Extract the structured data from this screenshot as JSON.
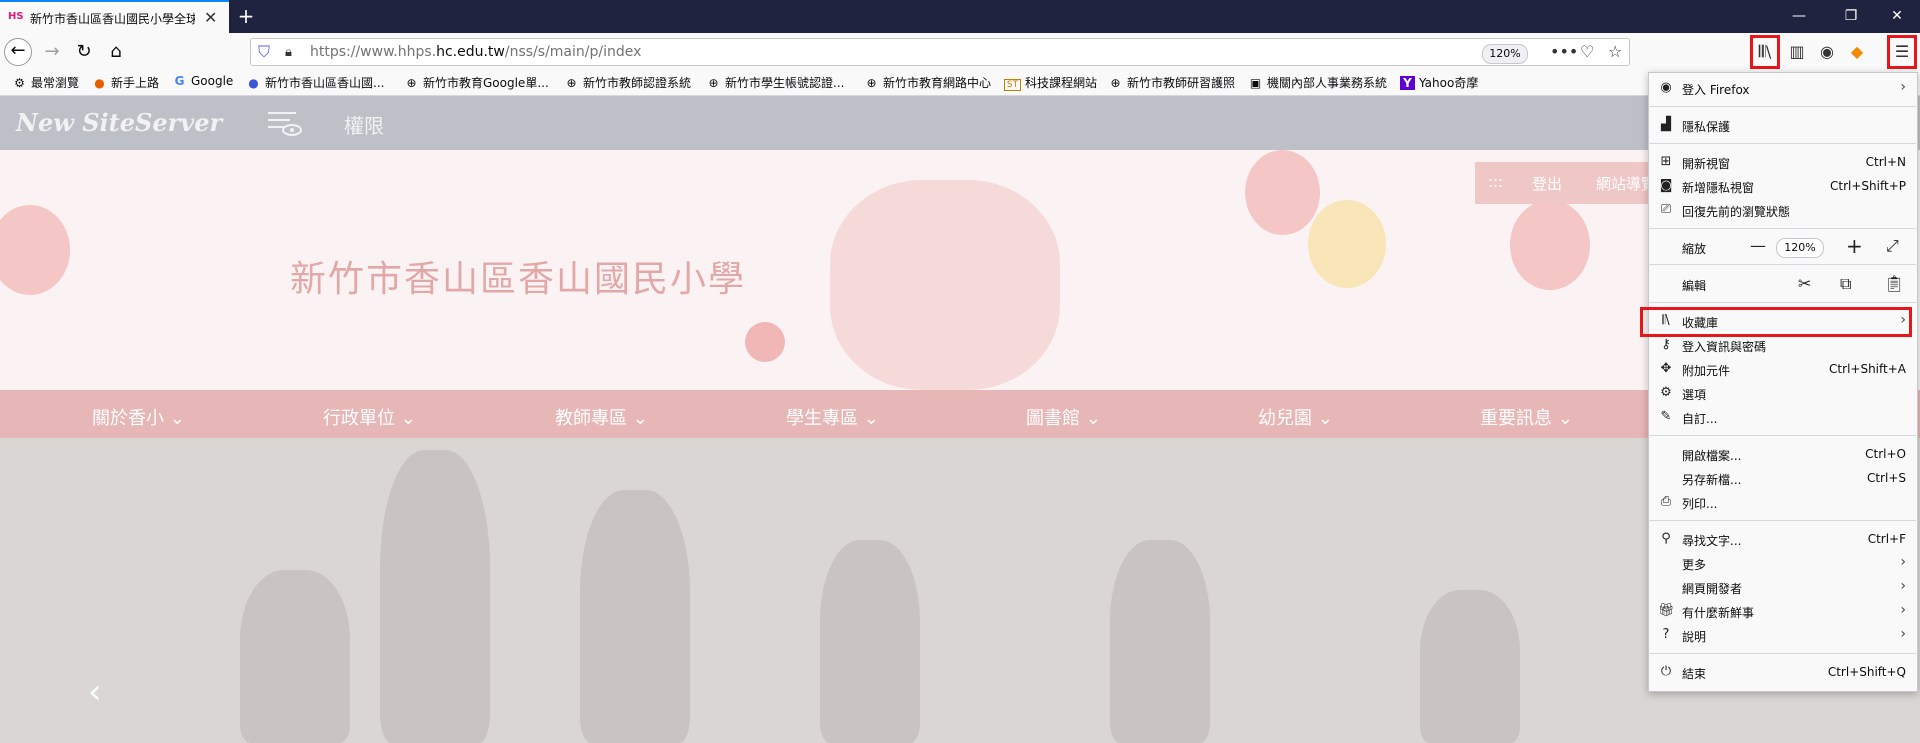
{
  "tab": {
    "favicon": "HS",
    "title": "新竹市香山區香山國民小學全球資訊網",
    "close": "✕"
  },
  "window": {
    "minimize": "—",
    "restore": "❐",
    "close": "✕",
    "new_tab": "+"
  },
  "nav": {
    "url_prefix": "https://www.hhps.",
    "url_domain": "hc.edu.tw",
    "url_suffix": "/nss/s/main/p/index",
    "zoom": "120%"
  },
  "bookmarks": [
    {
      "label": "最常瀏覽",
      "icon": "gear-icon"
    },
    {
      "label": "新手上路",
      "icon": "firefox-icon"
    },
    {
      "label": "Google",
      "icon": "google-icon"
    },
    {
      "label": "新竹市香山區香山國...",
      "icon": "firefox-icon"
    },
    {
      "label": "新竹市教育Google單...",
      "icon": "globe-icon"
    },
    {
      "label": "新竹市教師認證系統",
      "icon": "globe-icon"
    },
    {
      "label": "新竹市學生帳號認證...",
      "icon": "globe-icon"
    },
    {
      "label": "新竹市教育網路中心",
      "icon": "globe-icon"
    },
    {
      "label": "科技課程網站",
      "icon": "st-icon"
    },
    {
      "label": "新竹市教師研習護照",
      "icon": "globe-icon"
    },
    {
      "label": "機關內部人事業務系統",
      "icon": "image-icon"
    },
    {
      "label": "Yahoo奇摩",
      "icon": "yahoo-icon"
    }
  ],
  "site": {
    "logo": "New SiteServer",
    "permission": "權限",
    "school_name": "新竹市香山區香山國民小學",
    "top_links": [
      ":::",
      "登出",
      "網站導覽"
    ],
    "menu": [
      "關於香小",
      "行政單位",
      "教師專區",
      "學生專區",
      "圖書館",
      "幼兒園",
      "重要訊息"
    ],
    "prev_arrow": "‹"
  },
  "ff_menu": {
    "signin": "登入 Firefox",
    "privacy": "隱私保護",
    "new_window": "開新視窗",
    "new_window_sc": "Ctrl+N",
    "new_private": "新增隱私視窗",
    "new_private_sc": "Ctrl+Shift+P",
    "restore": "回復先前的瀏覽狀態",
    "zoom_label": "縮放",
    "zoom_value": "120%",
    "edit_label": "編輯",
    "library": "收藏庫",
    "logins": "登入資訊與密碼",
    "addons": "附加元件",
    "addons_sc": "Ctrl+Shift+A",
    "options": "選項",
    "customize": "自訂...",
    "open_file": "開啟檔案...",
    "open_file_sc": "Ctrl+O",
    "save_as": "另存新檔...",
    "save_as_sc": "Ctrl+S",
    "print": "列印...",
    "find": "尋找文字...",
    "find_sc": "Ctrl+F",
    "more": "更多",
    "webdev": "網頁開發者",
    "whatsnew": "有什麼新鮮事",
    "help": "說明",
    "quit": "結束",
    "quit_sc": "Ctrl+Shift+Q"
  },
  "colors": {
    "highlight_box": "#e8161b",
    "titlebar": "#202340",
    "menu_bg": "#f9f9fa"
  }
}
